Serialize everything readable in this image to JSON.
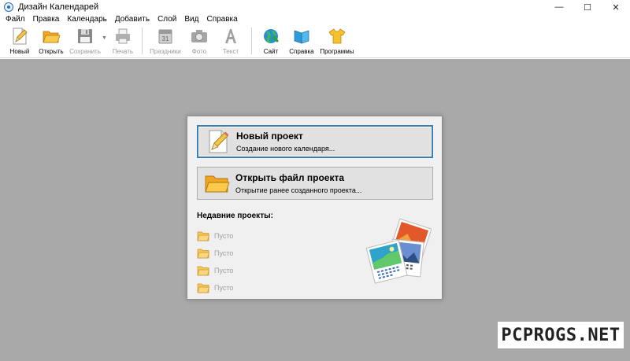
{
  "window": {
    "title": "Дизайн Календарей",
    "controls": {
      "minimize": "—",
      "maximize": "☐",
      "close": "✕"
    }
  },
  "menu": [
    "Файл",
    "Правка",
    "Календарь",
    "Добавить",
    "Слой",
    "Вид",
    "Справка"
  ],
  "toolbar": {
    "new": {
      "label": "Новый",
      "icon": "new-document-icon"
    },
    "open": {
      "label": "Открыть",
      "icon": "open-folder-icon"
    },
    "save": {
      "label": "Сохранить",
      "icon": "floppy-disk-icon"
    },
    "print": {
      "label": "Печать",
      "icon": "printer-icon"
    },
    "holidays": {
      "label": "Праздники",
      "icon": "calendar-icon"
    },
    "photo": {
      "label": "Фото",
      "icon": "camera-icon"
    },
    "text": {
      "label": "Текст",
      "icon": "text-a-icon"
    },
    "site": {
      "label": "Сайт",
      "icon": "globe-icon"
    },
    "help": {
      "label": "Справка",
      "icon": "book-icon"
    },
    "programs": {
      "label": "Программы",
      "icon": "tshirt-icon"
    }
  },
  "dialog": {
    "new_project": {
      "title": "Новый проект",
      "subtitle": "Создание нового календаря..."
    },
    "open_project": {
      "title": "Открыть файл проекта",
      "subtitle": "Открытие ранее созданного проекта..."
    },
    "recent_title": "Недавние проекты:",
    "recent_items": [
      "Пусто",
      "Пусто",
      "Пусто",
      "Пусто"
    ]
  },
  "watermark": "PCPROGS.NET",
  "colors": {
    "workspace": "#a9a9a9",
    "dialog": "#f0f0f0",
    "focus_border": "#3c7fb1",
    "folder": "#f5b731"
  }
}
